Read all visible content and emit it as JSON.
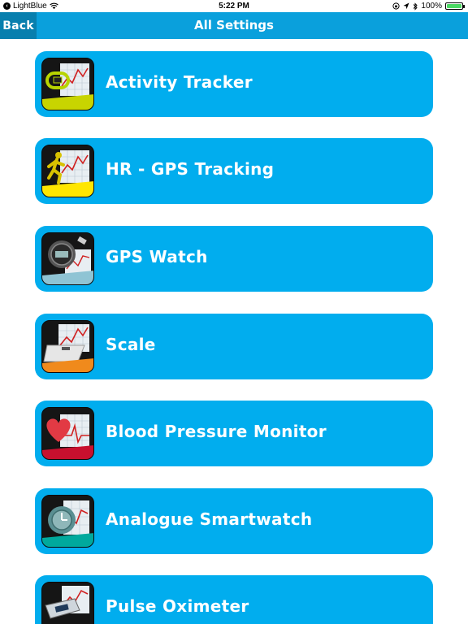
{
  "status_bar": {
    "back_app_label": "LightBlue",
    "time": "5:22 PM",
    "battery_percent": "100%",
    "battery_level": 1.0
  },
  "nav": {
    "back_label": "Back",
    "title": "All Settings",
    "bar_color": "#0aa0dc",
    "back_color": "#087fae"
  },
  "settings": {
    "row_color": "#01adee",
    "items": [
      {
        "label": "Activity Tracker",
        "icon": "activity-tracker-icon",
        "accent": "#c8d400"
      },
      {
        "label": "HR - GPS Tracking",
        "icon": "hr-gps-tracking-icon",
        "accent": "#ffe600"
      },
      {
        "label": "GPS Watch",
        "icon": "gps-watch-icon",
        "accent": "#8fc4d4"
      },
      {
        "label": "Scale",
        "icon": "scale-icon",
        "accent": "#f08a1c"
      },
      {
        "label": "Blood Pressure Monitor",
        "icon": "blood-pressure-monitor-icon",
        "accent": "#c8102e"
      },
      {
        "label": "Analogue Smartwatch",
        "icon": "analogue-smartwatch-icon",
        "accent": "#00a99d"
      },
      {
        "label": "Pulse Oximeter",
        "icon": "pulse-oximeter-icon",
        "accent": "#1d6fb8"
      }
    ]
  }
}
